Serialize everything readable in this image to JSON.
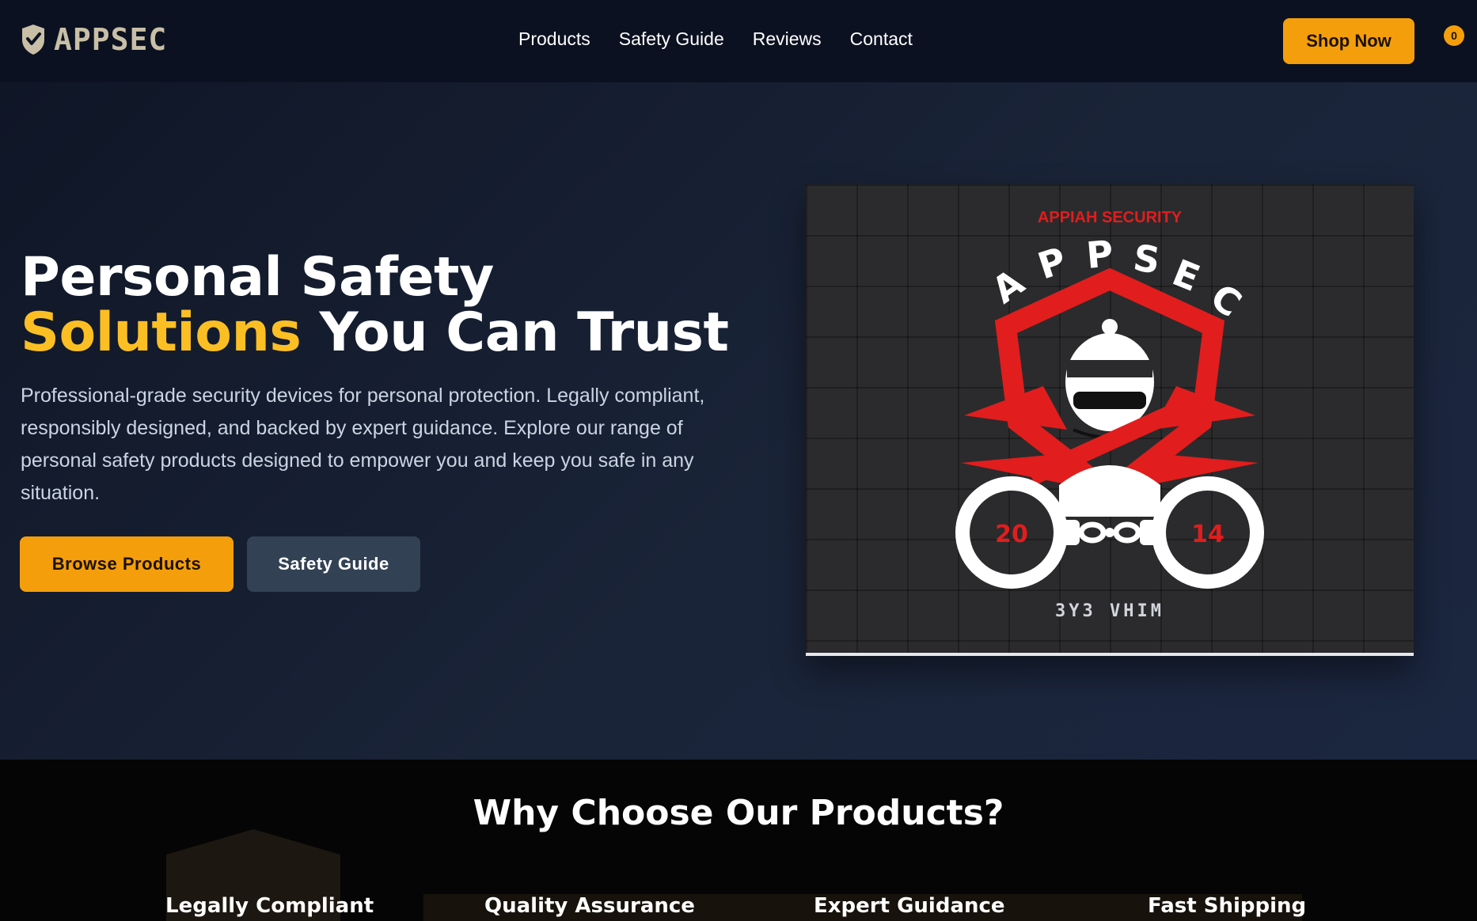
{
  "nav": {
    "brand": "APPSEC",
    "links": [
      "Products",
      "Safety Guide",
      "Reviews",
      "Contact"
    ],
    "shop_label": "Shop Now",
    "cart_count": "0"
  },
  "hero": {
    "title_line1": "Personal Safety",
    "title_accent": "Solutions",
    "title_rest": " You Can Trust",
    "description": "Professional-grade security devices for personal protection. Legally compliant, responsibly designed, and backed by expert guidance. Explore our range of personal safety products designed to empower you and keep you safe in any situation.",
    "primary_button": "Browse Products",
    "secondary_button": "Safety Guide",
    "image": {
      "top_caption": "APPIAH SECURITY",
      "arc_text": "APPSEC",
      "left_number": "20",
      "right_number": "14",
      "bottom_caption": "3Y3 VHIM"
    }
  },
  "features": {
    "title": "Why Choose Our Products?",
    "items": [
      "Legally Compliant",
      "Quality Assurance",
      "Expert Guidance",
      "Fast Shipping"
    ]
  },
  "colors": {
    "accent": "#f59e0b",
    "accent_text": "#fbbf24",
    "logo_red": "#e11d1d"
  }
}
